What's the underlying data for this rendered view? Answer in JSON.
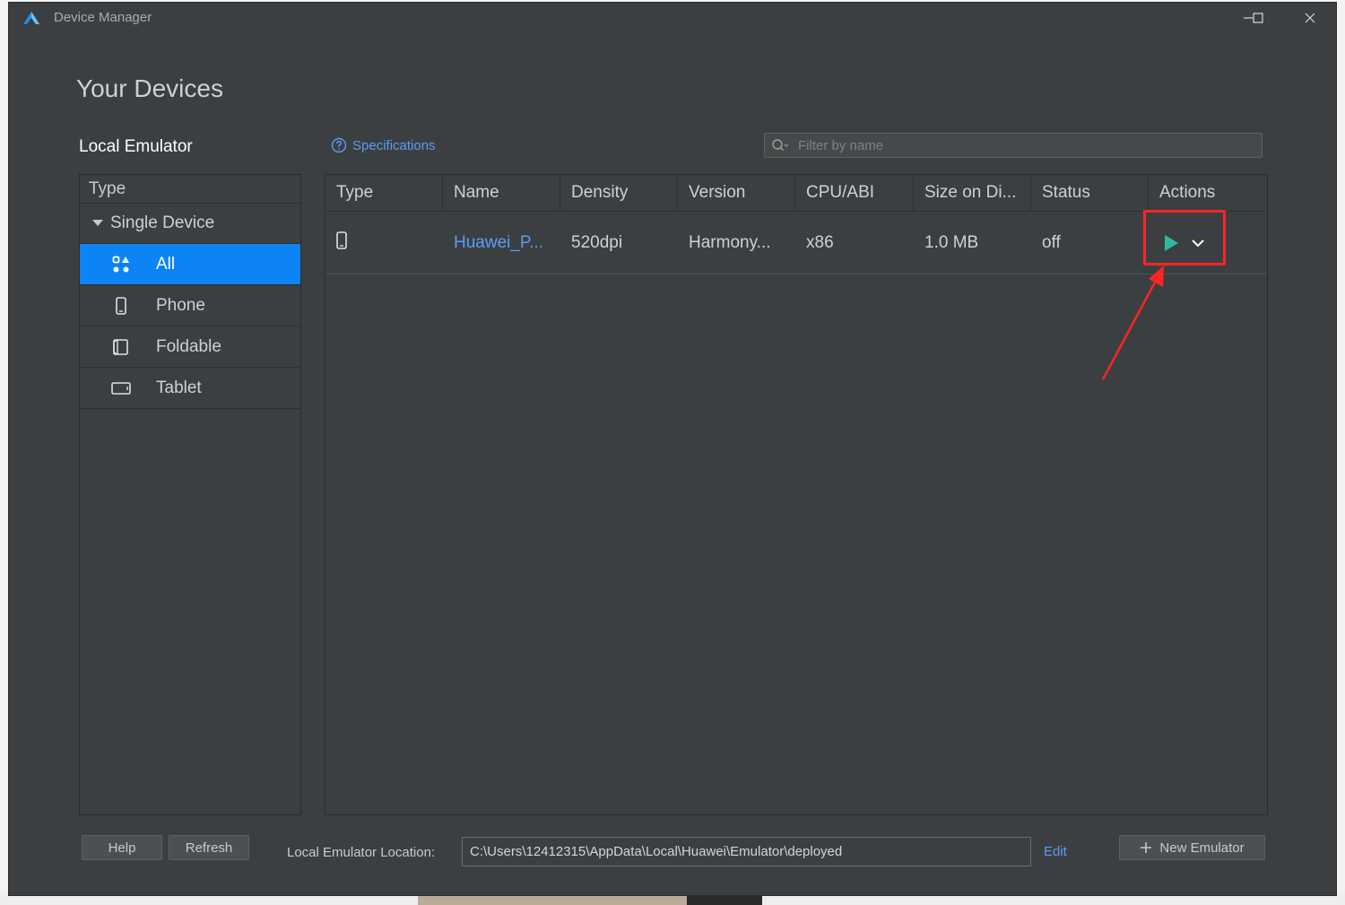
{
  "window": {
    "title": "Device Manager",
    "controls": {
      "minimize": "—",
      "maximize": "☐",
      "close": "✕"
    }
  },
  "heading": "Your Devices",
  "left": {
    "title": "Local Emulator",
    "type_header": "Type",
    "group": "Single Device",
    "items": [
      {
        "label": "All",
        "icon": "grid-shapes-icon",
        "selected": true
      },
      {
        "label": "Phone",
        "icon": "phone-icon",
        "selected": false
      },
      {
        "label": "Foldable",
        "icon": "foldable-icon",
        "selected": false
      },
      {
        "label": "Tablet",
        "icon": "tablet-icon",
        "selected": false
      }
    ]
  },
  "toolbar": {
    "specifications": "Specifications",
    "filter_placeholder": "Filter by name"
  },
  "table": {
    "columns": [
      "Type",
      "Name",
      "Density",
      "Version",
      "CPU/ABI",
      "Size on Di...",
      "Status",
      "Actions"
    ],
    "rows": [
      {
        "type_icon": "phone-icon",
        "name": "Huawei_P...",
        "density": "520dpi",
        "version": "Harmony...",
        "cpu": "x86",
        "size": "1.0 MB",
        "status": "off"
      }
    ]
  },
  "footer": {
    "help": "Help",
    "refresh": "Refresh",
    "location_label": "Local Emulator Location:",
    "location_value": "C:\\Users\\12412315\\AppData\\Local\\Huawei\\Emulator\\deployed",
    "edit": "Edit",
    "new_emulator": "New Emulator"
  },
  "colors": {
    "background": "#3c3f41",
    "selected": "#0d84f5",
    "link": "#589df6",
    "play": "#2fb8a0",
    "annotation": "#ff2424"
  }
}
